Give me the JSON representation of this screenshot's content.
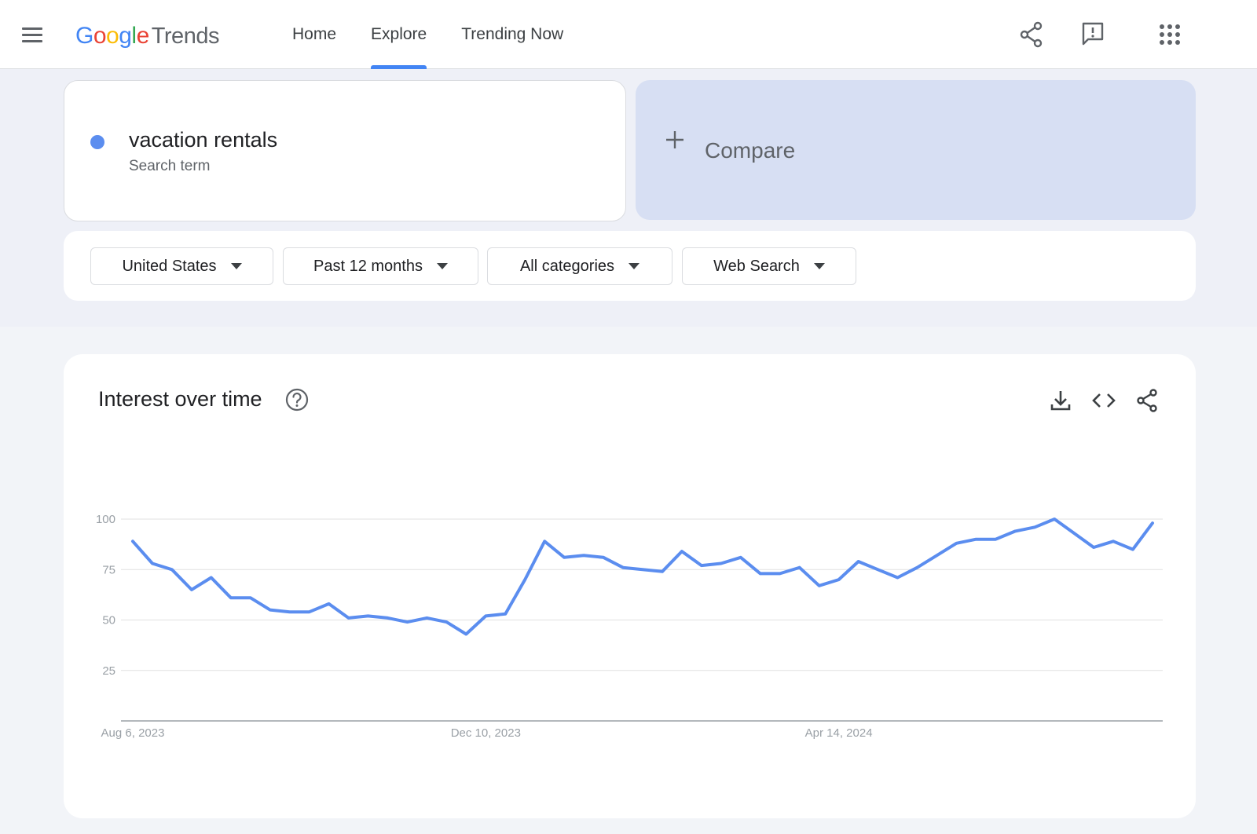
{
  "header": {
    "logo_google": [
      "G",
      "o",
      "o",
      "g",
      "l",
      "e"
    ],
    "logo_trends": "Trends",
    "nav": [
      {
        "label": "Home",
        "active": false
      },
      {
        "label": "Explore",
        "active": true
      },
      {
        "label": "Trending Now",
        "active": false
      }
    ],
    "icons": [
      "menu-icon",
      "share-icon",
      "feedback-icon",
      "apps-icon"
    ]
  },
  "search": {
    "term": "vacation rentals",
    "term_type": "Search term",
    "term_color": "#5b8def",
    "compare_label": "Compare"
  },
  "filters": [
    {
      "label": "United States"
    },
    {
      "label": "Past 12 months"
    },
    {
      "label": "All categories"
    },
    {
      "label": "Web Search"
    }
  ],
  "chart_card": {
    "title": "Interest over time",
    "icons": [
      "help-icon",
      "download-icon",
      "embed-icon",
      "share-icon"
    ]
  },
  "colors": {
    "accent": "#4285f4",
    "series": "#5b8def",
    "compare_bg": "#d7dff3"
  },
  "chart_data": {
    "type": "line",
    "title": "Interest over time",
    "xlabel": "",
    "ylabel": "",
    "ylim": [
      0,
      100
    ],
    "yticks": [
      25,
      50,
      75,
      100
    ],
    "x_tick_labels": [
      "Aug 6, 2023",
      "Dec 10, 2023",
      "Apr 14, 2024"
    ],
    "x_tick_indices": [
      0,
      18,
      36
    ],
    "grid": true,
    "series": [
      {
        "name": "vacation rentals",
        "values": [
          89,
          78,
          75,
          65,
          71,
          61,
          61,
          55,
          54,
          54,
          58,
          51,
          52,
          51,
          49,
          51,
          49,
          43,
          52,
          53,
          70,
          89,
          81,
          82,
          81,
          76,
          75,
          74,
          84,
          77,
          78,
          81,
          73,
          73,
          76,
          67,
          70,
          79,
          75,
          71,
          76,
          82,
          88,
          90,
          90,
          94,
          96,
          100,
          93,
          86,
          89,
          85,
          98
        ]
      }
    ]
  }
}
